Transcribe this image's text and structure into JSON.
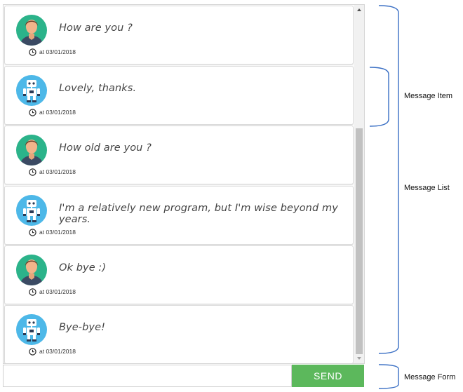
{
  "messages": [
    {
      "sender": "user",
      "avatar_icon": "user-avatar-icon",
      "text": "How are you ?",
      "timestamp": "at 03/01/2018"
    },
    {
      "sender": "bot",
      "avatar_icon": "robot-avatar-icon",
      "text": "Lovely, thanks.",
      "timestamp": "at 03/01/2018"
    },
    {
      "sender": "user",
      "avatar_icon": "user-avatar-icon",
      "text": "How old are you ?",
      "timestamp": "at 03/01/2018"
    },
    {
      "sender": "bot",
      "avatar_icon": "robot-avatar-icon",
      "text": "I'm a relatively new program, but I'm wise beyond my years.",
      "timestamp": "at 03/01/2018"
    },
    {
      "sender": "user",
      "avatar_icon": "user-avatar-icon",
      "text": "Ok bye :)",
      "timestamp": "at 03/01/2018"
    },
    {
      "sender": "bot",
      "avatar_icon": "robot-avatar-icon",
      "text": "Bye-bye!",
      "timestamp": "at 03/01/2018"
    }
  ],
  "form": {
    "input_value": "",
    "send_label": "SEND"
  },
  "annotations": {
    "message_item": "Message Item",
    "message_list": "Message List",
    "message_form": "Message Form"
  },
  "colors": {
    "send_button": "#5cb85c",
    "annotation_bracket": "#3a6fc4",
    "user_avatar_bg": "#2bb38a",
    "bot_avatar_bg": "#4db8e8"
  }
}
